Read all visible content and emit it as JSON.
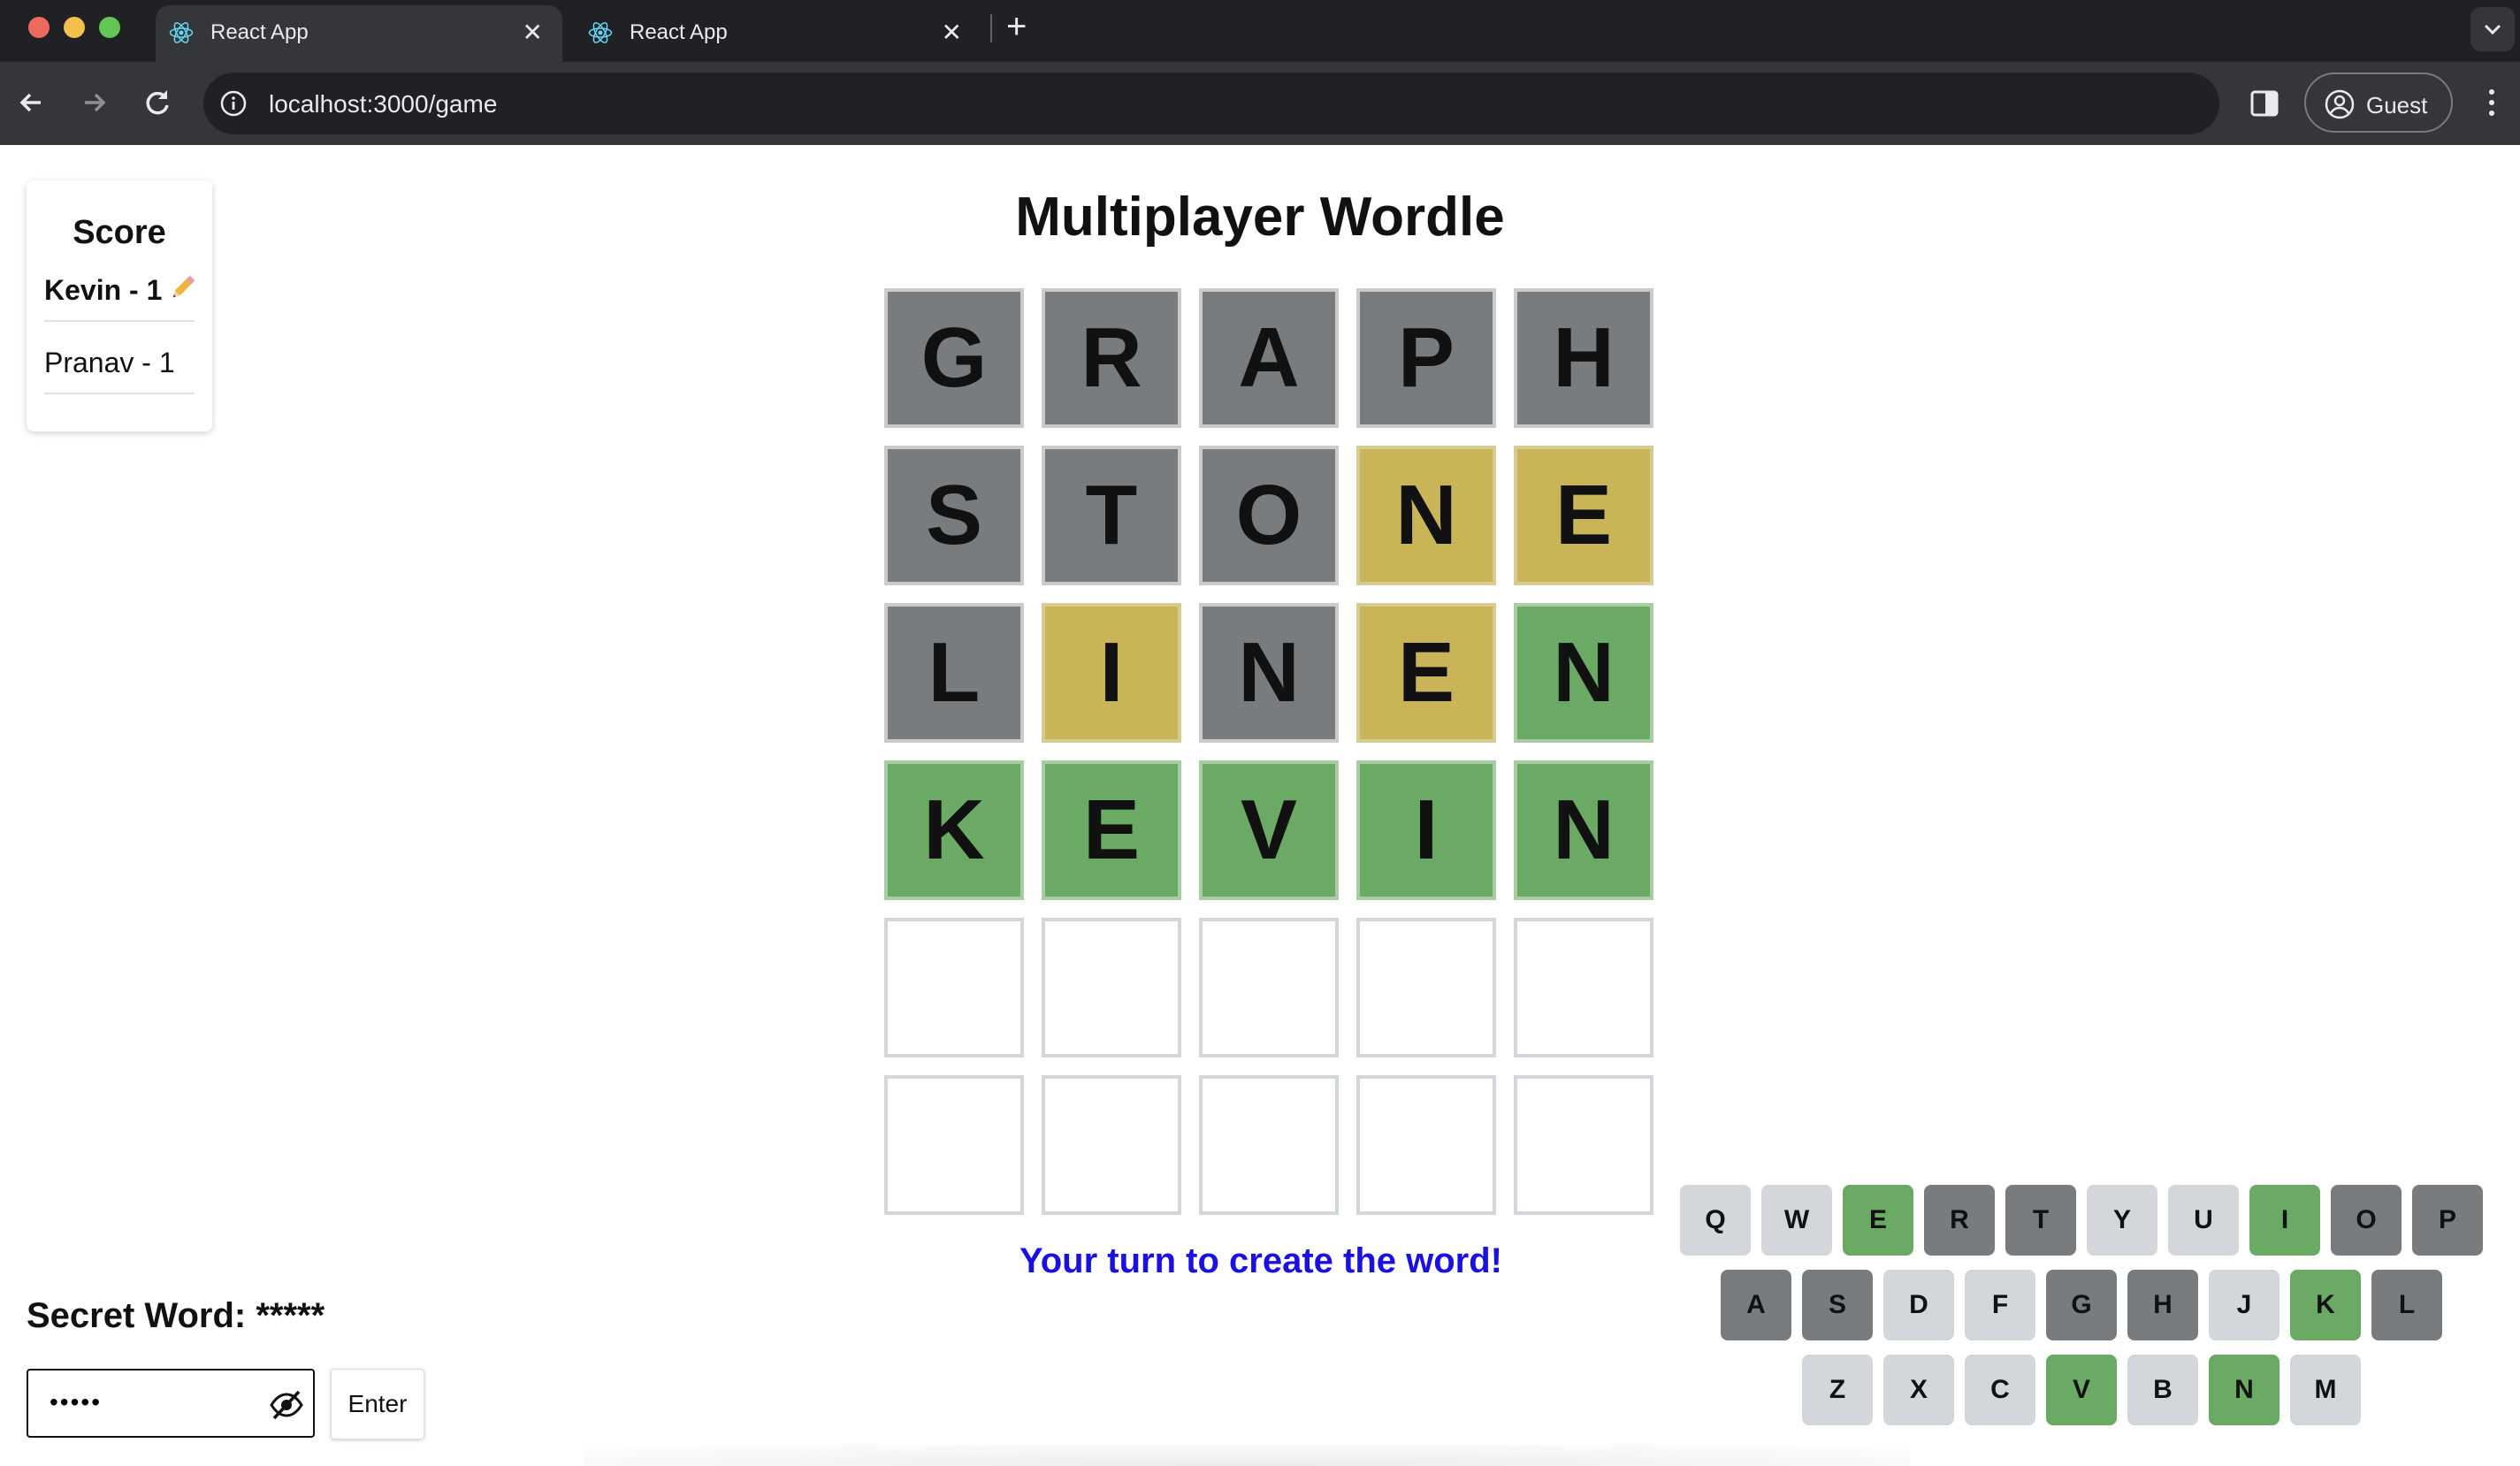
{
  "browser": {
    "tabs": [
      {
        "title": "React App",
        "active": true
      },
      {
        "title": "React App",
        "active": false
      }
    ],
    "url": "localhost:3000/game",
    "profile_label": "Guest"
  },
  "scoreboard": {
    "title": "Score",
    "players": [
      {
        "label": "Kevin - 1",
        "is_creator": true
      },
      {
        "label": "Pranav - 1",
        "is_creator": false
      }
    ]
  },
  "game": {
    "title": "Multiplayer Wordle",
    "colors": {
      "gray": "#787c7e",
      "yellow": "#c9b458",
      "green": "#6aaa64",
      "empty_border": "#d3d6da"
    },
    "rows": [
      [
        {
          "l": "G",
          "s": "gray"
        },
        {
          "l": "R",
          "s": "gray"
        },
        {
          "l": "A",
          "s": "gray"
        },
        {
          "l": "P",
          "s": "gray"
        },
        {
          "l": "H",
          "s": "gray"
        }
      ],
      [
        {
          "l": "S",
          "s": "gray"
        },
        {
          "l": "T",
          "s": "gray"
        },
        {
          "l": "O",
          "s": "gray"
        },
        {
          "l": "N",
          "s": "yellow"
        },
        {
          "l": "E",
          "s": "yellow"
        }
      ],
      [
        {
          "l": "L",
          "s": "gray"
        },
        {
          "l": "I",
          "s": "yellow"
        },
        {
          "l": "N",
          "s": "gray"
        },
        {
          "l": "E",
          "s": "yellow"
        },
        {
          "l": "N",
          "s": "green"
        }
      ],
      [
        {
          "l": "K",
          "s": "green"
        },
        {
          "l": "E",
          "s": "green"
        },
        {
          "l": "V",
          "s": "green"
        },
        {
          "l": "I",
          "s": "green"
        },
        {
          "l": "N",
          "s": "green"
        }
      ],
      [
        {
          "l": "",
          "s": "empty"
        },
        {
          "l": "",
          "s": "empty"
        },
        {
          "l": "",
          "s": "empty"
        },
        {
          "l": "",
          "s": "empty"
        },
        {
          "l": "",
          "s": "empty"
        }
      ],
      [
        {
          "l": "",
          "s": "empty"
        },
        {
          "l": "",
          "s": "empty"
        },
        {
          "l": "",
          "s": "empty"
        },
        {
          "l": "",
          "s": "empty"
        },
        {
          "l": "",
          "s": "empty"
        }
      ]
    ],
    "status_message": "Your turn to create the word!",
    "status_color": "#1a10e0"
  },
  "secret": {
    "label": "Secret Word: *****",
    "input_value": "•••••",
    "enter_label": "Enter"
  },
  "keyboard": {
    "rows": [
      [
        {
          "k": "Q",
          "s": "unused"
        },
        {
          "k": "W",
          "s": "unused"
        },
        {
          "k": "E",
          "s": "green"
        },
        {
          "k": "R",
          "s": "gray"
        },
        {
          "k": "T",
          "s": "gray"
        },
        {
          "k": "Y",
          "s": "unused"
        },
        {
          "k": "U",
          "s": "unused"
        },
        {
          "k": "I",
          "s": "green"
        },
        {
          "k": "O",
          "s": "gray"
        },
        {
          "k": "P",
          "s": "gray"
        }
      ],
      [
        {
          "k": "A",
          "s": "gray"
        },
        {
          "k": "S",
          "s": "gray"
        },
        {
          "k": "D",
          "s": "unused"
        },
        {
          "k": "F",
          "s": "unused"
        },
        {
          "k": "G",
          "s": "gray"
        },
        {
          "k": "H",
          "s": "gray"
        },
        {
          "k": "J",
          "s": "unused"
        },
        {
          "k": "K",
          "s": "green"
        },
        {
          "k": "L",
          "s": "gray"
        }
      ],
      [
        {
          "k": "Z",
          "s": "unused"
        },
        {
          "k": "X",
          "s": "unused"
        },
        {
          "k": "C",
          "s": "unused"
        },
        {
          "k": "V",
          "s": "green"
        },
        {
          "k": "B",
          "s": "unused"
        },
        {
          "k": "N",
          "s": "green"
        },
        {
          "k": "M",
          "s": "unused"
        }
      ]
    ]
  }
}
